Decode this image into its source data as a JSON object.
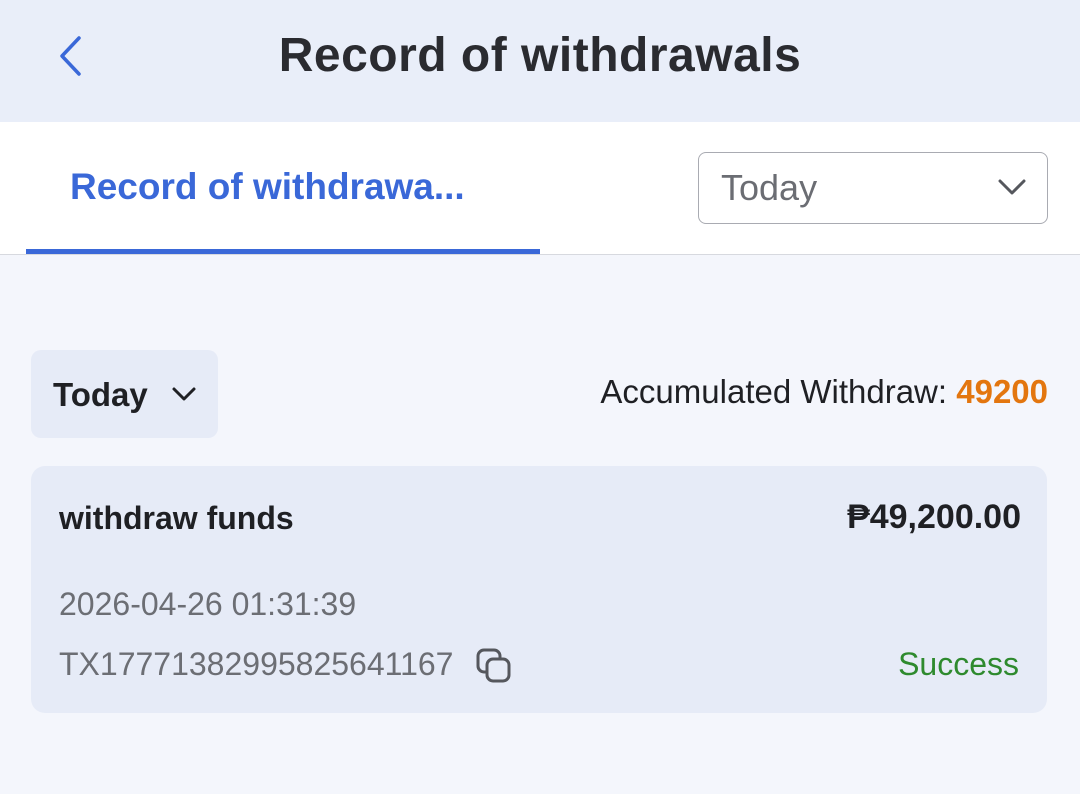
{
  "header": {
    "title": "Record of withdrawals",
    "back_icon": "chevron-left-icon"
  },
  "tabs": {
    "active_label": "Record of withdrawa..."
  },
  "range_select": {
    "selected": "Today"
  },
  "filter": {
    "label": "Today"
  },
  "summary": {
    "label": "Accumulated Withdraw: ",
    "value": "49200"
  },
  "records": [
    {
      "type": "withdraw funds",
      "amount": "₱49,200.00",
      "time": "2026-04-26 01:31:39",
      "txid": "TX1777138299582564116​7",
      "status": "Success"
    }
  ],
  "colors": {
    "accent": "#3a68d8",
    "highlight": "#e3760f",
    "success": "#2e8a2e"
  }
}
